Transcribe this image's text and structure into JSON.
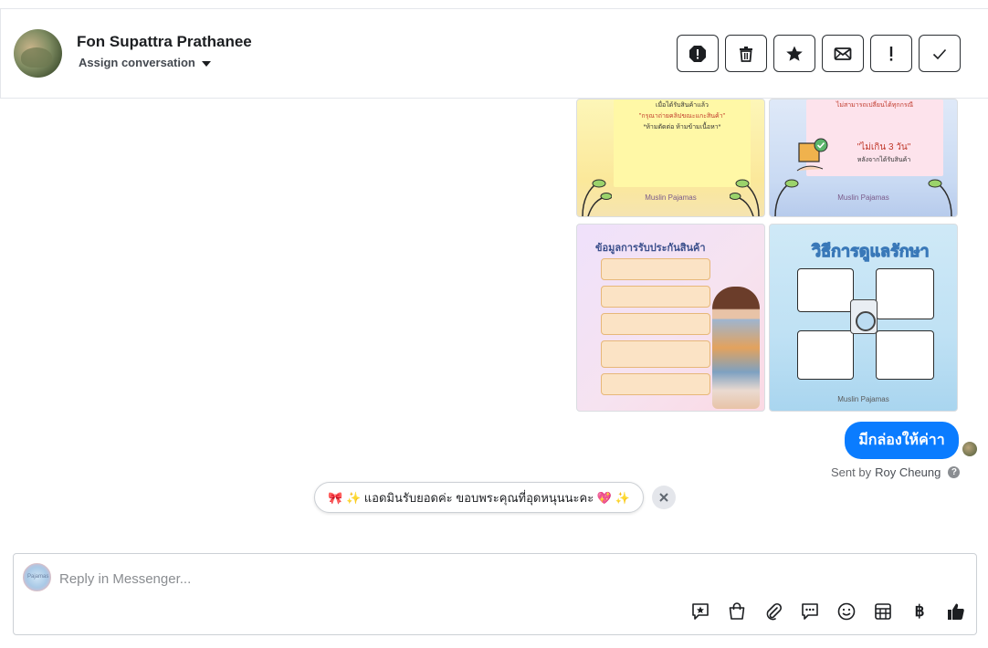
{
  "header": {
    "contact_name": "Fon Supattra Prathanee",
    "assign_label": "Assign conversation",
    "toolbar": [
      {
        "name": "report-spam-button",
        "icon": "alert-octagon-icon"
      },
      {
        "name": "delete-button",
        "icon": "trash-icon"
      },
      {
        "name": "star-button",
        "icon": "star-icon"
      },
      {
        "name": "mark-unread-button",
        "icon": "envelope-icon"
      },
      {
        "name": "follow-up-button",
        "icon": "exclamation-icon"
      },
      {
        "name": "mark-done-button",
        "icon": "checkmark-icon"
      }
    ]
  },
  "images": {
    "tile1": {
      "line1": "เมื่อได้รับสินค้าแล้ว",
      "line2": "\"กรุณาถ่ายคลิปขณะแกะสินค้า\"",
      "line3": "*ห้ามตัดต่อ ห้ามข้ามเนื้อหา*",
      "footer": "Muslin Pajamas"
    },
    "tile2": {
      "line1": "ไม่สามารถเปลี่ยนได้ทุกกรณี",
      "line2": "\"ไม่เกิน 3 วัน\"",
      "line3": "หลังจากได้รับสินค้า",
      "footer": "Muslin Pajamas"
    },
    "tile3": {
      "title": "ข้อมูลการรับประกันสินค้า"
    },
    "tile4": {
      "title": "วิธีการดูแลรักษา",
      "footer": "Muslin Pajamas"
    }
  },
  "message": {
    "text": "มีกล่องให้ค่าา",
    "sent_by_prefix": "Sent by",
    "sent_by_name": "Roy Cheung"
  },
  "suggestion": {
    "text": "🎀 ✨ แอดมินรับยอดค่ะ ขอบพระคุณที่อุดหนุนนะคะ 💖 ✨"
  },
  "composer": {
    "placeholder": "Reply in Messenger...",
    "avatar_text": "Pajamas",
    "baht_symbol": "฿"
  }
}
